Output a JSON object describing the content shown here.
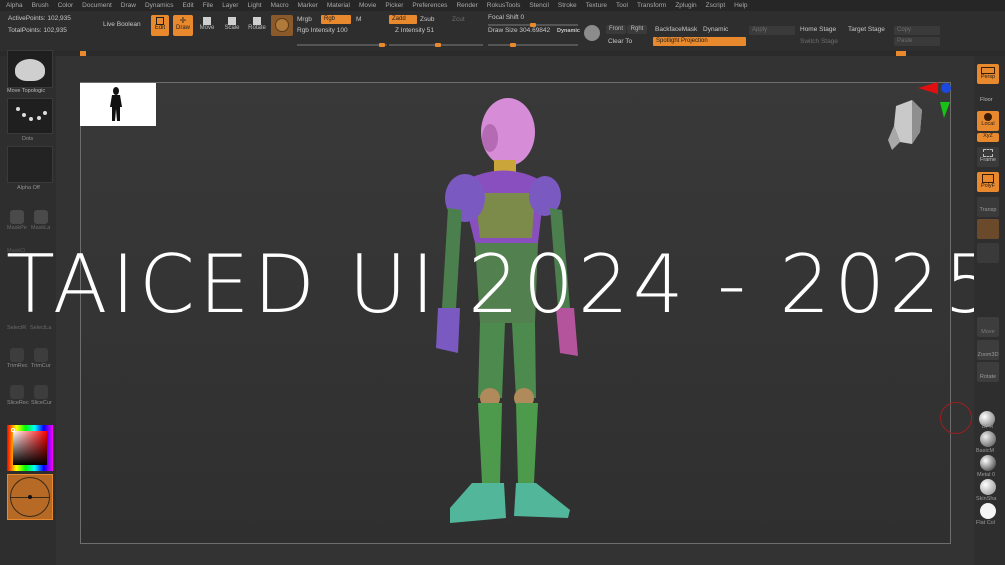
{
  "menu": [
    "Alpha",
    "Brush",
    "Color",
    "Document",
    "Draw",
    "Dynamics",
    "Edit",
    "File",
    "Layer",
    "Light",
    "Macro",
    "Marker",
    "Material",
    "Movie",
    "Picker",
    "Preferences",
    "Render",
    "RokusTools",
    "Stencil",
    "Stroke",
    "Texture",
    "Tool",
    "Transform",
    "Zplugin",
    "Zscript",
    "Help"
  ],
  "stats": {
    "active": "ActivePoints: 102,935",
    "total": "TotalPoints: 102,935"
  },
  "toolbar": {
    "live_boolean": "Live Boolean",
    "edit": "Edit",
    "draw": "Draw",
    "move": "Move",
    "scale": "Scale",
    "rotate": "Rotate",
    "mrgb": "Mrgb",
    "rgb": "Rgb",
    "m": "M",
    "rgb_intensity": "Rgb Intensity 100",
    "zadd": "Zadd",
    "zsub": "Zsub",
    "zcut": "Zcut",
    "z_intensity": "Z Intensity 51",
    "focal_shift": "Focal Shift 0",
    "draw_size": "Draw Size 304.69842",
    "dynamic": "Dynamic",
    "front": "Front",
    "right": "Rght",
    "clear_to": "Clear To",
    "backface_mask": "BackfaceMask",
    "dynamic2": "Dynamic",
    "spotlight": "Spotlight Projection",
    "apply": "Apply",
    "home_stage": "Home Stage",
    "target_stage": "Target Stage",
    "switch_stage": "Switch Stage",
    "copy": "Copy",
    "paste": "Paste"
  },
  "leftshelf": {
    "brush": "Move Topologic",
    "stroke": "Dots",
    "alpha": "Alpha Off",
    "mask_pen": "MaskPe",
    "mask_lasso": "MaskLa",
    "mask_circle": "MaskCi",
    "select_rect": "SelectR",
    "select_lasso": "SelectLa",
    "trim_rect": "TrimRec",
    "trim_curve": "TrimCur",
    "slice_rect": "SliceRec",
    "slice_curve": "SliceCur"
  },
  "headline": "TAICED UI 2024 - 2025",
  "rightshelf": {
    "persp": "Persp",
    "floor": "Floor",
    "local": "Local",
    "xyz": "XyZ",
    "frame": "Frame",
    "polyf": "PolyF",
    "transp": "Transp",
    "move": "Move",
    "zoom3d": "Zoom3D",
    "rotate": "Rotate",
    "mat_bpr": "BPR",
    "mat_basic": "BasicM",
    "mat_metal": "Metal 0",
    "mat_skin": "SkinSha",
    "mat_flat": "Flat Col"
  },
  "colors": {
    "accent": "#e8892e",
    "bg": "#2b2b2b"
  }
}
